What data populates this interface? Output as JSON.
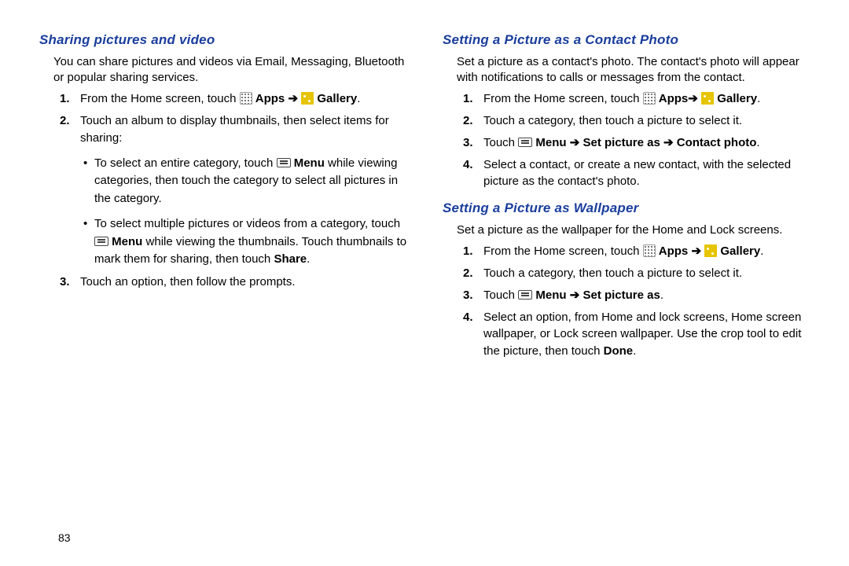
{
  "page_number": "83",
  "arrows": {
    "r": "➔"
  },
  "labels": {
    "apps": "Apps",
    "gallery": "Gallery",
    "menu": "Menu",
    "share": "Share",
    "done": "Done",
    "set_picture_as": "Set picture as",
    "contact_photo": "Contact photo"
  },
  "left": {
    "h": "Sharing pictures and video",
    "intro": "You can share pictures and videos via Email, Messaging, Bluetooth or popular sharing services.",
    "s1a": "From the Home screen, touch ",
    "s1b": ".",
    "s2": "Touch an album to display thumbnails, then select items for sharing:",
    "b1a": "To select an entire category, touch ",
    "b1b": " while viewing categories, then touch the category to select all pictures in the category.",
    "b2a": "To select multiple pictures or videos from a category, touch ",
    "b2b": " while viewing the thumbnails. Touch thumbnails to mark them for sharing, then touch ",
    "b2c": ".",
    "s3": "Touch an option, then follow the prompts."
  },
  "contact": {
    "h": "Setting a Picture as a Contact Photo",
    "intro": "Set a picture as a contact's photo. The contact's photo will appear with notifications to calls or messages from the contact.",
    "s1a": "From the Home screen, touch ",
    "s1b": ".",
    "s2": "Touch a category, then touch a picture to select it.",
    "s3a": "Touch ",
    "s3b": ".",
    "s4": "Select a contact, or create a new contact, with the selected picture as the contact's photo."
  },
  "wall": {
    "h": "Setting a Picture as Wallpaper",
    "intro": "Set a picture as the wallpaper for the Home and Lock screens.",
    "s1a": "From the Home screen, touch ",
    "s1b": ".",
    "s2": "Touch a category, then touch a picture to select it.",
    "s3a": "Touch ",
    "s3b": ".",
    "s4a": "Select an option, from Home and lock screens, Home screen wallpaper, or Lock screen wallpaper. Use the crop tool to edit the picture, then touch ",
    "s4b": "."
  }
}
